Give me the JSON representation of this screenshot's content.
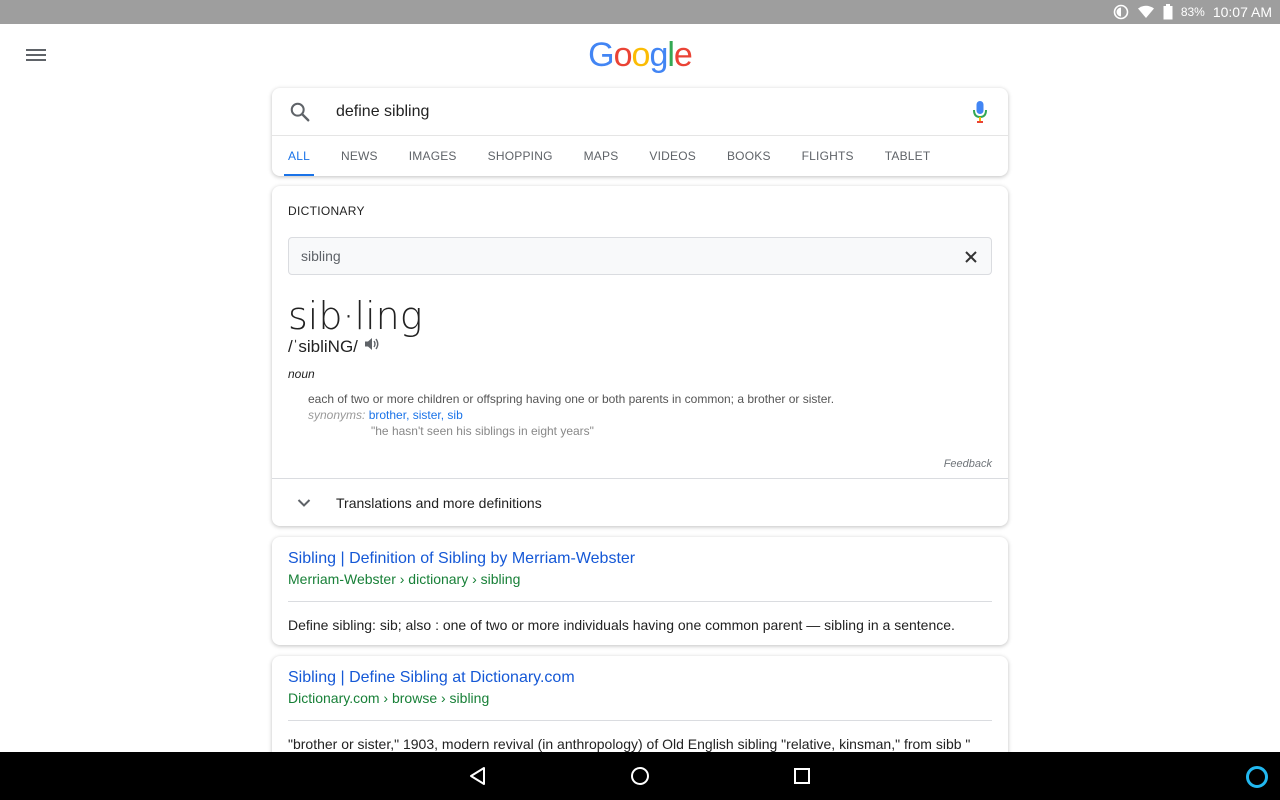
{
  "status_bar": {
    "battery": "83%",
    "time": "10:07 AM"
  },
  "logo": {
    "letters": [
      "G",
      "o",
      "o",
      "g",
      "l",
      "e"
    ],
    "colors": [
      "#4285F4",
      "#EA4335",
      "#FBBC05",
      "#4285F4",
      "#34A853",
      "#EA4335"
    ]
  },
  "search": {
    "query": "define sibling",
    "tabs": [
      "ALL",
      "NEWS",
      "IMAGES",
      "SHOPPING",
      "MAPS",
      "VIDEOS",
      "BOOKS",
      "FLIGHTS",
      "TABLET"
    ],
    "active_tab": "ALL"
  },
  "dictionary": {
    "title": "DICTIONARY",
    "input_value": "sibling",
    "word": "sib·ling",
    "phonetic": "/ˈsibliNG/",
    "part_of_speech": "noun",
    "definition": "each of two or more children or offspring having one or both parents in common; a brother or sister.",
    "synonyms_label": "synonyms:",
    "synonyms": [
      "brother",
      "sister",
      "sib"
    ],
    "example": "\"he hasn't seen his siblings in eight years\"",
    "feedback": "Feedback",
    "more_label": "Translations and more definitions"
  },
  "results": [
    {
      "title": "Sibling | Definition of Sibling by Merriam-Webster",
      "url": "Merriam-Webster › dictionary › sibling",
      "snippet": "Define sibling: sib; also : one of two or more individuals having one common parent — sibling in a sentence."
    },
    {
      "title": "Sibling | Define Sibling at Dictionary.com",
      "url": "Dictionary.com › browse › sibling",
      "snippet": "\"brother or sister,\" 1903, modern revival (in anthropology) of Old English sibling \"relative, kinsman,\" from sibb \""
    }
  ],
  "colors": {
    "accent": "#1a73e8",
    "link": "#1558d6",
    "url_green": "#188038",
    "status_bar": "#9e9e9e",
    "assistant": "#22b8f0"
  }
}
